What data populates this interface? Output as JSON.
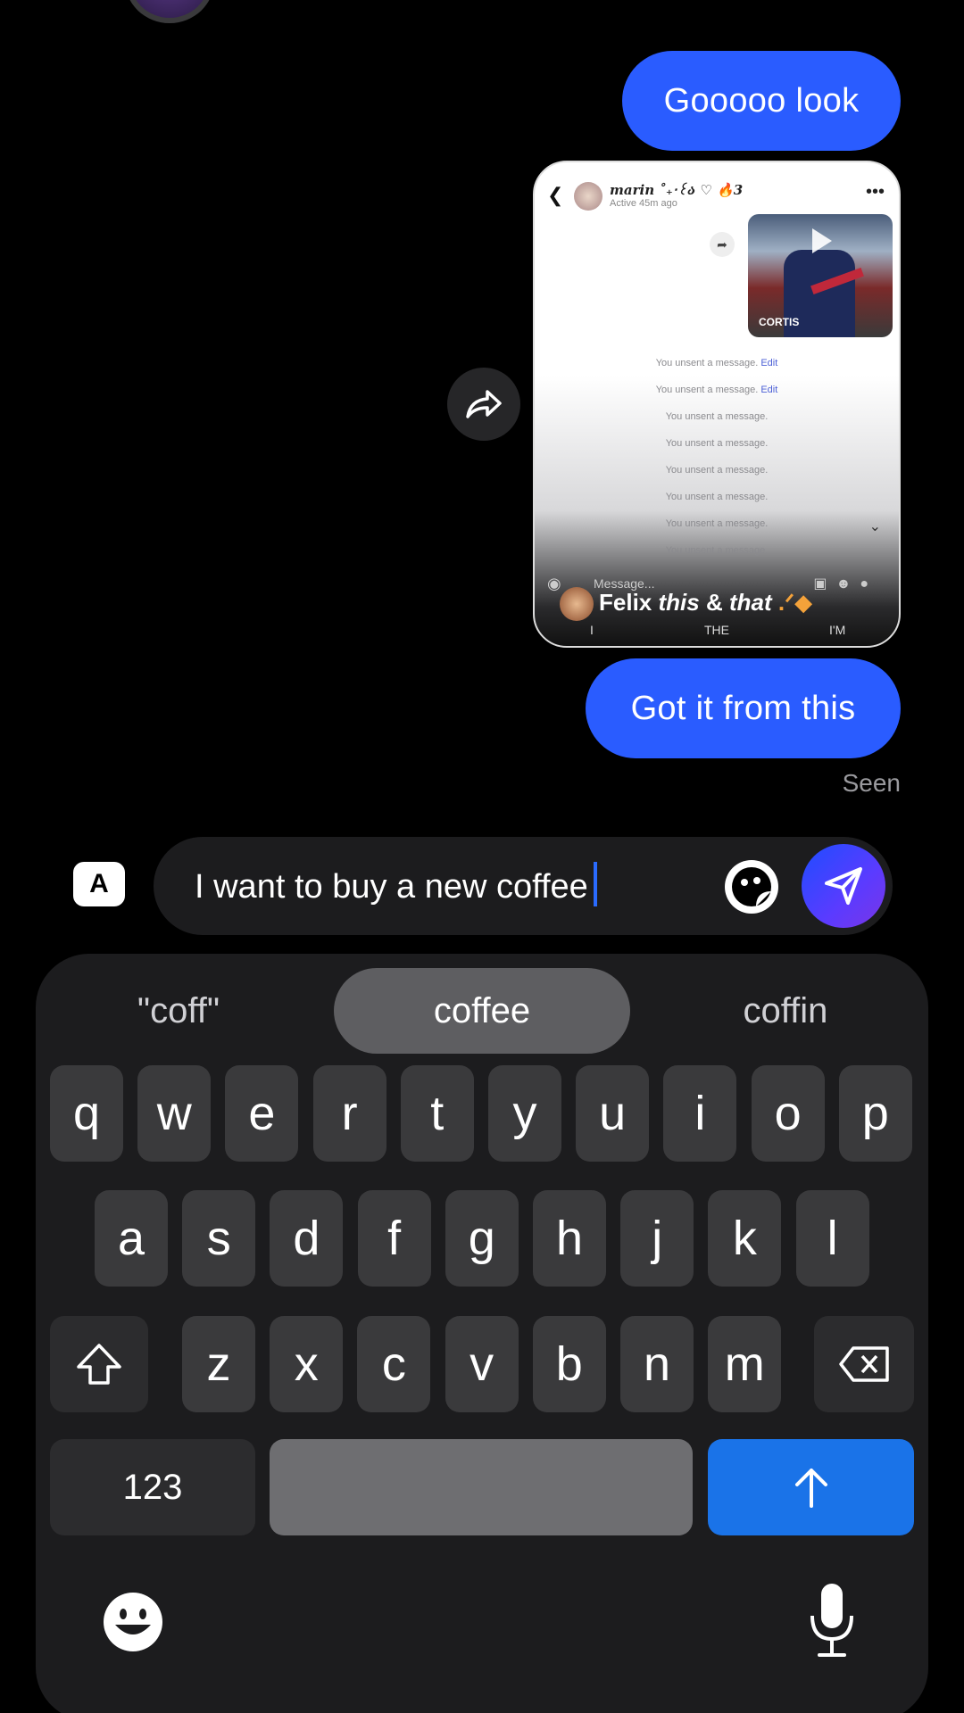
{
  "messages": {
    "bubble_1": "Gooooo look",
    "bubble_2": "Got it from this",
    "seen": "Seen"
  },
  "shared_screenshot": {
    "contact_name": "marin ˚₊‧꒰ა ♡ 🔥3",
    "active": "Active 45m ago",
    "video_tag": "CORTIS",
    "unsent_lines": [
      {
        "text": "You unsent a message.",
        "action": "Edit"
      },
      {
        "text": "You unsent a message.",
        "action": "Edit"
      },
      {
        "text": "You unsent a message.",
        "action": ""
      },
      {
        "text": "You unsent a message.",
        "action": ""
      },
      {
        "text": "You unsent a message.",
        "action": ""
      },
      {
        "text": "You unsent a message.",
        "action": ""
      },
      {
        "text": "You unsent a message.",
        "action": ""
      },
      {
        "text": "You unsent a message.",
        "action": ""
      }
    ],
    "message_placeholder": "Message...",
    "caption_name": "Felix",
    "caption_rest_1": "this",
    "caption_mid": "&",
    "caption_rest_2": "that",
    "predictions": [
      "I",
      "THE",
      "I'M"
    ]
  },
  "composer": {
    "keyboard_switch_label": "A",
    "text": "I want to buy a new coffee"
  },
  "keyboard": {
    "suggestions": [
      "\"coff\"",
      "coffee",
      "coffin"
    ],
    "row1": [
      "q",
      "w",
      "e",
      "r",
      "t",
      "y",
      "u",
      "i",
      "o",
      "p"
    ],
    "row2": [
      "a",
      "s",
      "d",
      "f",
      "g",
      "h",
      "j",
      "k",
      "l"
    ],
    "row3": [
      "z",
      "x",
      "c",
      "v",
      "b",
      "n",
      "m"
    ],
    "numbers_label": "123"
  },
  "colors": {
    "bubble": "#2a5cff",
    "enter_key": "#1a73e8",
    "background": "#000000"
  }
}
